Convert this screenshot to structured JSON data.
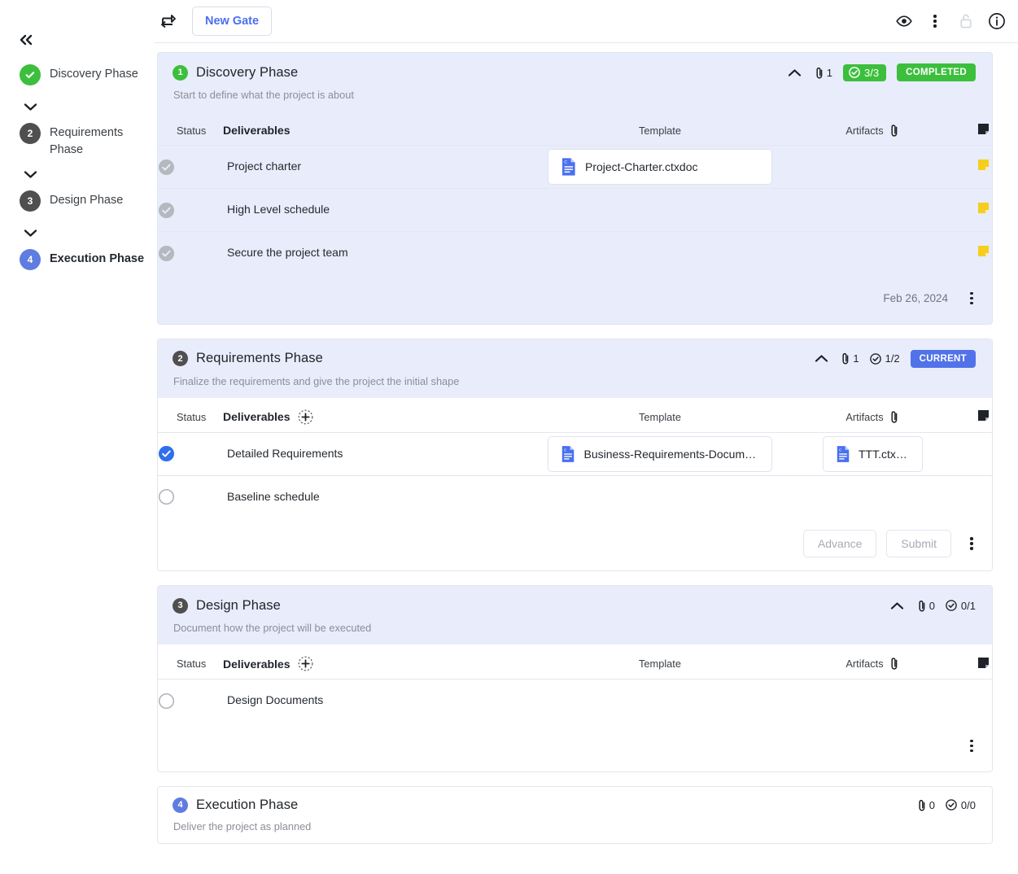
{
  "sidebar": {
    "collapse_label": "«",
    "items": [
      {
        "badge": "check",
        "label": "Discovery Phase",
        "badge_color": "#3cbf3c",
        "active": false
      },
      {
        "badge": "2",
        "label": "Requirements Phase",
        "badge_color": "#4f4f4f",
        "active": false
      },
      {
        "badge": "3",
        "label": "Design Phase",
        "badge_color": "#4f4f4f",
        "active": false
      },
      {
        "badge": "4",
        "label": "Execution Phase",
        "badge_color": "#5f7ce0",
        "active": true
      }
    ]
  },
  "toolbar": {
    "swap_icon": "swap-arrows-icon",
    "new_gate_label": "New Gate",
    "right_icons": [
      "eye-icon",
      "vertical-dots-icon",
      "lock-icon",
      "info-icon"
    ]
  },
  "table_headers": {
    "status": "Status",
    "deliverables": "Deliverables",
    "template": "Template",
    "artifacts": "Artifacts",
    "notes_icon": "sticky-note-icon"
  },
  "phases": [
    {
      "number": "1",
      "title": "Discovery Phase",
      "description": "Start to define what the project is about",
      "attachments": "1",
      "checks": "3/3",
      "status_label": "COMPLETED",
      "status_color": "#3cbf3c",
      "footer_date": "Feb 26, 2024",
      "rows": [
        {
          "status": "done-grey",
          "name": "Project charter",
          "template": "Project-Charter.ctxdoc",
          "artifact": "",
          "note": "yellow"
        },
        {
          "status": "done-grey",
          "name": "High Level schedule",
          "template": "",
          "artifact": "",
          "note": "yellow"
        },
        {
          "status": "done-grey",
          "name": "Secure the project team",
          "template": "",
          "artifact": "",
          "note": "yellow"
        }
      ]
    },
    {
      "number": "2",
      "title": "Requirements Phase",
      "description": "Finalize the requirements and give the project the initial shape",
      "attachments": "1",
      "checks": "1/2",
      "status_label": "CURRENT",
      "status_color": "#5172e8",
      "buttons": {
        "advance": "Advance",
        "submit": "Submit"
      },
      "rows": [
        {
          "status": "done-blue",
          "name": "Detailed Requirements",
          "template": "Business-Requirements-Document-...",
          "artifact": "TTT.ctxdoc",
          "note": ""
        },
        {
          "status": "pending",
          "name": "Baseline schedule",
          "template": "",
          "artifact": "",
          "note": ""
        }
      ]
    },
    {
      "number": "3",
      "title": "Design Phase",
      "description": "Document how the project will be executed",
      "attachments": "0",
      "checks": "0/1",
      "status_label": "",
      "rows": [
        {
          "status": "pending",
          "name": "Design Documents",
          "template": "",
          "artifact": "",
          "note": ""
        }
      ]
    },
    {
      "number": "4",
      "title": "Execution Phase",
      "description": "Deliver the project as planned",
      "attachments": "0",
      "checks": "0/0",
      "status_label": "",
      "rows": []
    }
  ]
}
